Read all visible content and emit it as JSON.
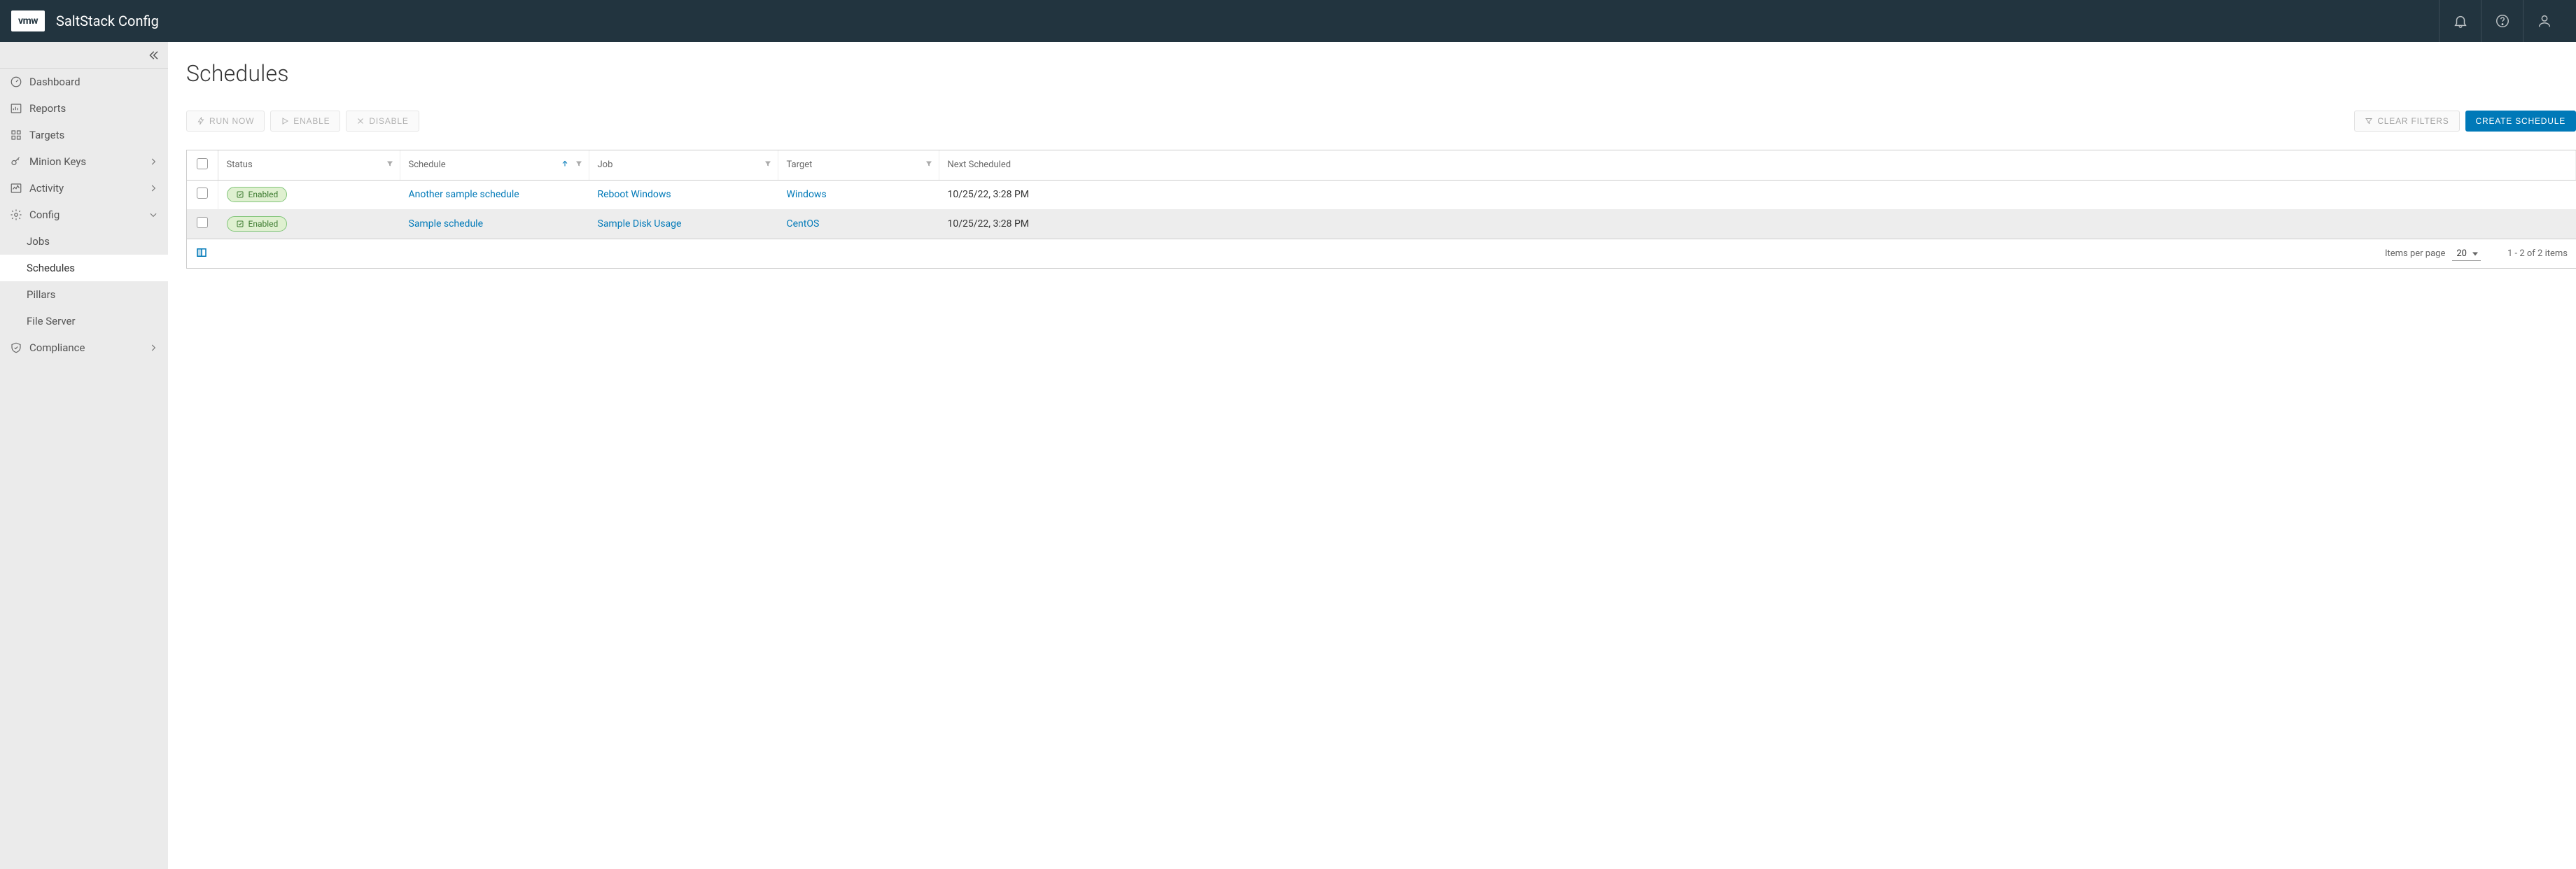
{
  "brand": "vmw",
  "product": "SaltStack Config",
  "sidebar": {
    "items": [
      {
        "label": "Dashboard"
      },
      {
        "label": "Reports"
      },
      {
        "label": "Targets"
      },
      {
        "label": "Minion Keys"
      },
      {
        "label": "Activity"
      },
      {
        "label": "Config"
      },
      {
        "label": "Compliance"
      }
    ],
    "config_children": [
      {
        "label": "Jobs"
      },
      {
        "label": "Schedules"
      },
      {
        "label": "Pillars"
      },
      {
        "label": "File Server"
      }
    ]
  },
  "page": {
    "title": "Schedules"
  },
  "actions": {
    "run_now": "Run Now",
    "enable": "Enable",
    "disable": "Disable",
    "clear_filters": "Clear Filters",
    "create": "Create Schedule"
  },
  "columns": {
    "status": "Status",
    "schedule": "Schedule",
    "job": "Job",
    "target": "Target",
    "next": "Next Scheduled"
  },
  "rows": [
    {
      "status": "Enabled",
      "schedule": "Another sample schedule",
      "job": "Reboot Windows",
      "target": "Windows",
      "next": "10/25/22, 3:28 PM"
    },
    {
      "status": "Enabled",
      "schedule": "Sample schedule",
      "job": "Sample Disk Usage",
      "target": "CentOS",
      "next": "10/25/22, 3:28 PM"
    }
  ],
  "footer": {
    "items_per_page_label": "Items per page",
    "items_per_page_value": "20",
    "range_text": "1 - 2 of 2 items"
  }
}
